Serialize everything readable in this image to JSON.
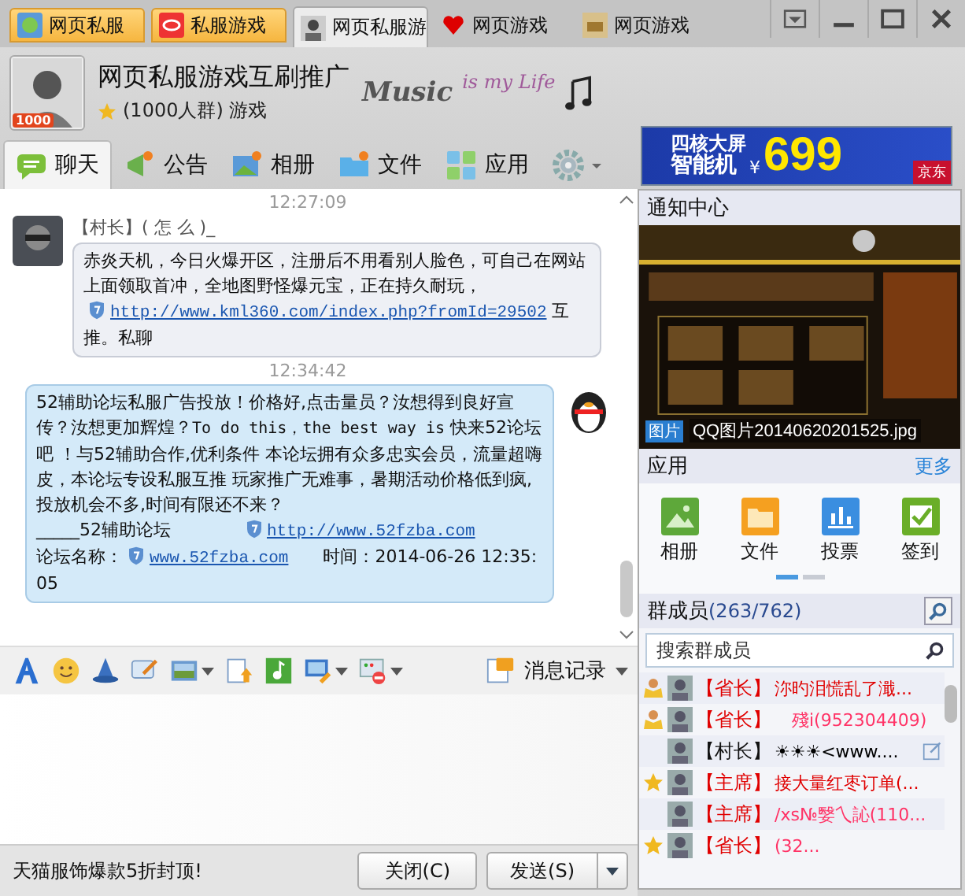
{
  "window_tabs": [
    {
      "label": "网页私服",
      "selected": false,
      "flashing": true
    },
    {
      "label": "私服游戏",
      "selected": false,
      "flashing": true
    },
    {
      "label": "网页私服游",
      "selected": true,
      "flashing": false
    },
    {
      "label": "网页游戏",
      "selected": false,
      "flashing": false
    },
    {
      "label": "网页游戏",
      "selected": false,
      "flashing": false
    }
  ],
  "group": {
    "name": "网页私服游戏互刷推广",
    "badge": "1000",
    "subtitle": "(1000人群) 游戏",
    "skin_text": [
      "Music",
      "is my Life"
    ]
  },
  "nav_tabs": [
    {
      "label": "聊天",
      "selected": true
    },
    {
      "label": "公告",
      "selected": false
    },
    {
      "label": "相册",
      "selected": false
    },
    {
      "label": "文件",
      "selected": false
    },
    {
      "label": "应用",
      "selected": false
    }
  ],
  "ad": {
    "line1": "四核大屏",
    "line2": "智能机",
    "currency": "¥",
    "price": "699",
    "brand": "京东"
  },
  "messages": [
    {
      "time": "12:27:09",
      "kind": "incoming",
      "sender": "【村长】(  怎  么  )_",
      "parts": [
        {
          "kind": "text",
          "text": "赤炎天机，今日火爆开区，注册后不用看别人脸色，可自己在网站上面领取首冲，全地图野怪爆元宝，正在持久耐玩，"
        },
        {
          "kind": "link",
          "text": "http://www.kml360.com/index.php?fromId=29502"
        },
        {
          "kind": "text",
          "text": " 互推。私聊"
        }
      ]
    },
    {
      "time": "12:34:42",
      "kind": "outgoing",
      "parts": [
        {
          "kind": "text",
          "text": "52辅助论坛私服广告投放！价格好,点击量员？汝想得到良好宣传？汝想更加辉煌？"
        },
        {
          "kind": "code",
          "text": "To do this，the best way is"
        },
        {
          "kind": "text",
          "text": " 快来52论坛吧 ！与52辅助合作,优利条件 本论坛拥有众多忠实会员，流量超嗨皮，本论坛专设私服互推 玩家推广无难事，暑期活动价格低到疯,投放机会不多,时间有限还不来？"
        },
        {
          "kind": "break"
        },
        {
          "kind": "text",
          "text": "_____52辅助论坛　　　　"
        },
        {
          "kind": "link",
          "text": "http://www.52fzba.com"
        },
        {
          "kind": "break"
        },
        {
          "kind": "text",
          "text": "论坛名称："
        },
        {
          "kind": "link",
          "text": "www.52fzba.com"
        },
        {
          "kind": "text",
          "text": "　　时间：2014-06-26 12:35:05"
        }
      ]
    }
  ],
  "history": {
    "label": "消息记录"
  },
  "status_text": "天猫服饰爆款5折封顶!",
  "buttons": {
    "close": "关闭(C)",
    "send": "发送(S)"
  },
  "notice": {
    "title": "通知中心",
    "badge": "图片",
    "caption": "QQ图片20140620201525.jpg"
  },
  "apps": {
    "title": "应用",
    "more": "更多",
    "items": [
      {
        "label": "相册"
      },
      {
        "label": "文件"
      },
      {
        "label": "投票"
      },
      {
        "label": "签到"
      }
    ],
    "pages": [
      {
        "selected": true
      },
      {
        "selected": false
      }
    ]
  },
  "members": {
    "title": "群成员",
    "count": "(263/762)",
    "search_placeholder": "搜索群成员",
    "rows": [
      {
        "kind": "owner",
        "title": "【省长】",
        "title_red": true,
        "name": "沵旳泪慌乱了濈...",
        "color": "#e00000",
        "editable": false
      },
      {
        "kind": "owner",
        "title": "【省长】",
        "title_red": true,
        "name": "　殘i(952304409)",
        "color": "#ff3366",
        "editable": false
      },
      {
        "kind": "member",
        "title": "【村长】",
        "title_red": false,
        "name": "☀☀☀<www....",
        "color": "#000000",
        "editable": true
      },
      {
        "kind": "vip",
        "title": "【主席】",
        "title_red": true,
        "name": "接大量红枣订单(...",
        "color": "#e00000",
        "editable": false
      },
      {
        "kind": "member",
        "title": "【主席】",
        "title_red": true,
        "name": "/xs№嫛乀訫(110...",
        "color": "#ff3366",
        "editable": false
      },
      {
        "kind": "vip",
        "title": "【省长】",
        "title_red": true,
        "name": "(32...",
        "color": "#ff3366",
        "editable": false
      }
    ]
  }
}
